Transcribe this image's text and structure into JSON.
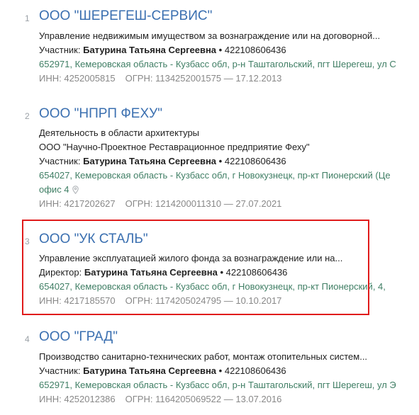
{
  "results": [
    {
      "number": "1",
      "title": "ООО \"ШЕРЕГЕШ-СЕРВИС\"",
      "description": "Управление недвижимым имуществом за вознаграждение или на договорной...",
      "role": "Участник:",
      "person_name": "Батурина Татьяна Сергеевна",
      "person_inn": "422108606436",
      "address": "652971, Кемеровская область - Кузбасс обл, р-н Таштагольский, пгт Шерегеш, ул С",
      "inn": "ИНН: 4252005815",
      "ogrn": "ОГРН: 1134252001575 — 17.12.2013"
    },
    {
      "number": "2",
      "title": "ООО \"НПРП ФЕХУ\"",
      "description": "Деятельность в области архитектуры",
      "full_name": "ООО \"Научно-Проектное Реставрационное предприятие Феху\"",
      "role": "Участник:",
      "person_name": "Батурина Татьяна Сергеевна",
      "person_inn": "422108606436",
      "address": "654027, Кемеровская область - Кузбасс обл, г Новокузнецк, пр-кт Пионерский (Це",
      "address_cont": "офис 4",
      "inn": "ИНН: 4217202627",
      "ogrn": "ОГРН: 1214200011310 — 27.07.2021"
    },
    {
      "number": "3",
      "title": "ООО \"УК СТАЛЬ\"",
      "description": "Управление эксплуатацией жилого фонда за вознаграждение или на...",
      "role": "Директор:",
      "person_name": "Батурина Татьяна Сергеевна",
      "person_inn": "422108606436",
      "address": "654027, Кемеровская область - Кузбасс обл, г Новокузнецк, пр-кт Пионерский, 4,",
      "inn": "ИНН: 4217185570",
      "ogrn": "ОГРН: 1174205024795 — 10.10.2017"
    },
    {
      "number": "4",
      "title": "ООО \"ГРАД\"",
      "description": "Производство санитарно-технических работ, монтаж отопительных систем...",
      "role": "Участник:",
      "person_name": "Батурина Татьяна Сергеевна",
      "person_inn": "422108606436",
      "address": "652971, Кемеровская область - Кузбасс обл, р-н Таштагольский, пгт Шерегеш, ул Э",
      "inn": "ИНН: 4252012386",
      "ogrn": "ОГРН: 1164205069522 — 13.07.2016"
    }
  ],
  "separator": "•",
  "colors": {
    "title": "#3a6fb0",
    "address": "#3f7e64",
    "meta": "#888888",
    "highlight_border": "#e01b1b"
  },
  "icons": {
    "address_pin": "location-pin-icon"
  }
}
